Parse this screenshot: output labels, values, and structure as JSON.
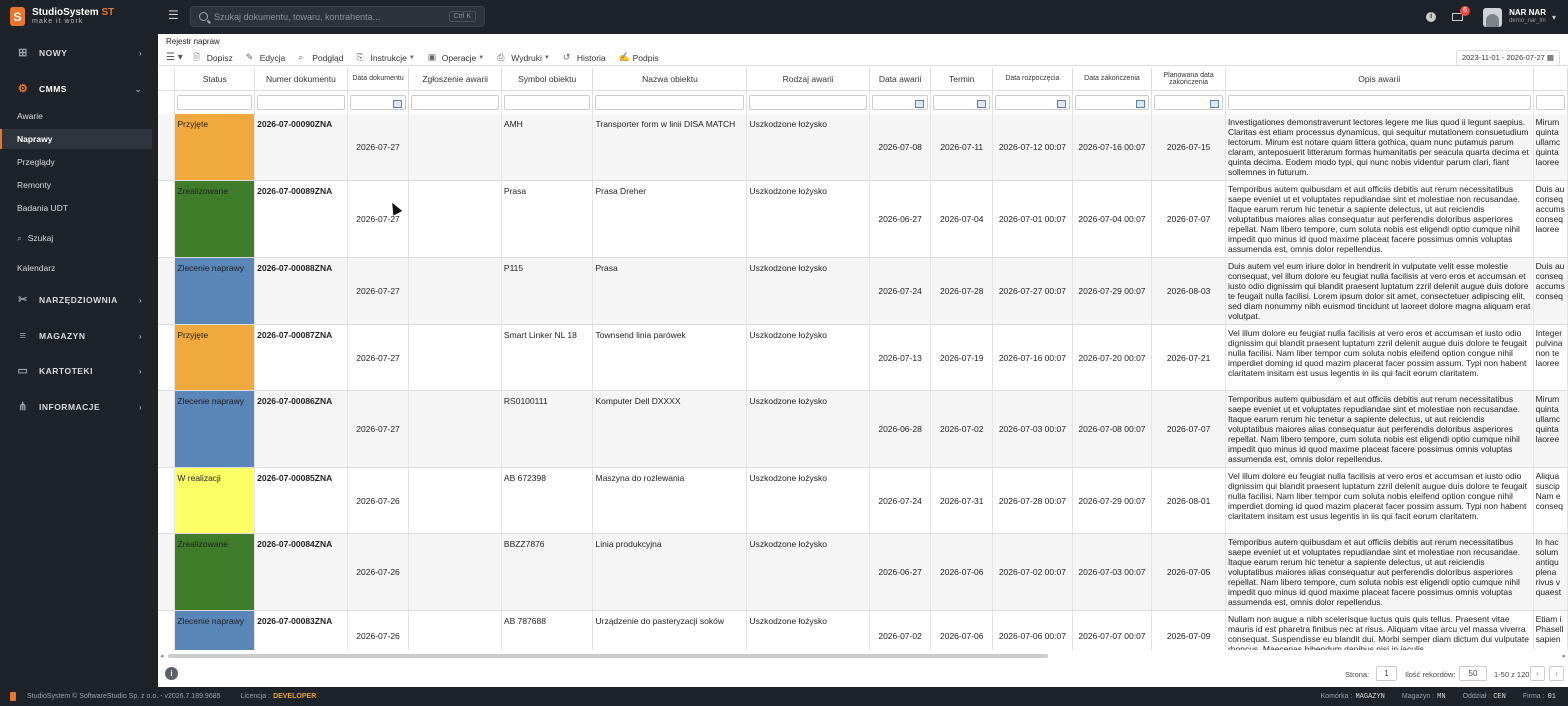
{
  "app": {
    "name": "StudioSystem",
    "name_suffix": "ST",
    "tagline": "make it work"
  },
  "search": {
    "placeholder": "Szukaj dokumentu, towaru, kontrahenta...",
    "shortcut": "Ctrl K"
  },
  "header": {
    "mail_badge": "6",
    "user_name": "NAR NAR",
    "user_login": "demo_nar_lm"
  },
  "sidebar": {
    "groups": [
      {
        "label": "NOWY",
        "icon": "plus-square-icon"
      },
      {
        "label": "CMMS",
        "icon": "gears-icon"
      },
      {
        "label": "NARZĘDZIOWNIA",
        "icon": "tools-icon"
      },
      {
        "label": "MAGAZYN",
        "icon": "pallet-icon"
      },
      {
        "label": "KARTOTEKI",
        "icon": "folder-icon"
      },
      {
        "label": "INFORMACJE",
        "icon": "sitemap-icon"
      }
    ],
    "cmms_items": [
      "Awarie",
      "Naprawy",
      "Przeglądy",
      "Remonty",
      "Badania UDT"
    ],
    "search_label": "Szukaj",
    "calendar_label": "Kalendarz"
  },
  "breadcrumb": "Rejestr napraw",
  "toolbar": {
    "items": [
      "Dopisz",
      "Edycja",
      "Podgląd",
      "Instrukcje",
      "Operacje",
      "Wydruki",
      "Historia",
      "Podpis"
    ],
    "date_range": "2023-11-01 - 2026-07-27"
  },
  "table": {
    "columns": [
      "Status",
      "Numer dokumentu",
      "Data dokumentu",
      "Zgłoszenie awarii",
      "Symbol obiektu",
      "Nazwa obiektu",
      "Rodzaj awarii",
      "Data awarii",
      "Termin",
      "Data rozpoczęcia",
      "Data zakończenia",
      "Planowana data zakończenia",
      "Opis awarii"
    ],
    "rows": [
      {
        "status": "Przyjęte",
        "status_color": "#f0a93c",
        "numer": "2026-07-00090ZNA",
        "data_dok": "2026-07-27",
        "zgloszenie": "",
        "symbol": "AMH",
        "nazwa": "Transporter form w linii DISA MATCH",
        "rodzaj": "Uszkodzone łożysko",
        "data_awarii": "2026-07-08",
        "termin": "2026-07-11",
        "data_rozp": "2026-07-12 00:07",
        "data_zak": "2026-07-16 00:07",
        "plan_zak": "2026-07-15",
        "opis": "Investigationes demonstraverunt lectores legere me lius quod ii legunt saepius. Claritas est etiam processus dynamicus, qui sequitur mutationem consuetudium lectorum. Mirum est notare quam littera gothica, quam nunc putamus parum claram, anteposuerit litterarum formas humanitatis per seacula quarta decima et quinta decima. Eodem modo typi, qui nunc nobis videntur parum clari, fiant sollemnes in futurum.",
        "opis2": "Mirum quinta ullamc quinta laoree"
      },
      {
        "status": "Zrealizowane",
        "status_color": "#3f7d2a",
        "numer": "2026-07-00089ZNA",
        "data_dok": "2026-07-27",
        "zgloszenie": "",
        "symbol": "Prasa",
        "nazwa": "Prasa Dreher",
        "rodzaj": "Uszkodzone łożysko",
        "data_awarii": "2026-06-27",
        "termin": "2026-07-04",
        "data_rozp": "2026-07-01 00:07",
        "data_zak": "2026-07-04 00:07",
        "plan_zak": "2026-07-07",
        "opis": "Temporibus autem quibusdam et aut officiis debitis aut rerum necessitatibus saepe eveniet ut et voluptates repudiandae sint et molestiae non recusandae. Itaque earum rerum hic tenetur a sapiente delectus, ut aut reiciendis voluptatibus maiores alias consequatur aut perferendis doloribus asperiores repellat. Nam libero tempore, cum soluta nobis est eligendi optio cumque nihil impedit quo minus id quod maxime placeat facere possimus omnis voluptas assumenda est, omnis dolor repellendus.",
        "opis2": "Duis au conseq accums conseq laoree"
      },
      {
        "status": "Zlecenie naprawy",
        "status_color": "#5b86b8",
        "numer": "2026-07-00088ZNA",
        "data_dok": "2026-07-27",
        "zgloszenie": "",
        "symbol": "P115",
        "nazwa": "Prasa",
        "rodzaj": "Uszkodzone łożysko",
        "data_awarii": "2026-07-24",
        "termin": "2026-07-28",
        "data_rozp": "2026-07-27 00:07",
        "data_zak": "2026-07-29 00:07",
        "plan_zak": "2026-08-03",
        "opis": "Duis autem vel eum iriure dolor in hendrerit in vulputate velit esse molestie consequat, vel illum dolore eu feugiat nulla facilisis at vero eros et accumsan et iusto odio dignissim qui blandit praesent luptatum zzril delenit augue duis dolore te feugait nulla facilisi. Lorem ipsum dolor sit amet, consectetuer adipiscing elit, sed diam nonummy nibh euismod tincidunt ut laoreet dolore magna aliquam erat volutpat.",
        "opis2": "Duis au conseq accums conseq"
      },
      {
        "status": "Przyjęte",
        "status_color": "#f0a93c",
        "numer": "2026-07-00087ZNA",
        "data_dok": "2026-07-27",
        "zgloszenie": "",
        "symbol": "Smart Linker NL 18",
        "nazwa": "Townsend linia parówek",
        "rodzaj": "Uszkodzone łożysko",
        "data_awarii": "2026-07-13",
        "termin": "2026-07-19",
        "data_rozp": "2026-07-16 00:07",
        "data_zak": "2026-07-20 00:07",
        "plan_zak": "2026-07-21",
        "opis": "Vel illum dolore eu feugiat nulla facilisis at vero eros et accumsan et iusto odio dignissim qui blandit praesent luptatum zzril delenit augue duis dolore te feugait nulla facilisi. Nam liber tempor cum soluta nobis eleifend option congue nihil imperdiet doming id quod mazim placerat facer possim assum. Typi non habent claritatem insitam est usus legentis in iis qui facit eorum claritatem.",
        "opis2": "Integer pulvina non te laoree"
      },
      {
        "status": "Zlecenie naprawy",
        "status_color": "#5b86b8",
        "numer": "2026-07-00086ZNA",
        "data_dok": "2026-07-27",
        "zgloszenie": "",
        "symbol": "RS0100111",
        "nazwa": "Komputer Dell DXXXX",
        "rodzaj": "Uszkodzone łożysko",
        "data_awarii": "2026-06-28",
        "termin": "2026-07-02",
        "data_rozp": "2026-07-03 00:07",
        "data_zak": "2026-07-08 00:07",
        "plan_zak": "2026-07-07",
        "opis": "Temporibus autem quibusdam et aut officiis debitis aut rerum necessitatibus saepe eveniet ut et voluptates repudiandae sint et molestiae non recusandae. Itaque earum rerum hic tenetur a sapiente delectus, ut aut reiciendis voluptatibus maiores alias consequatur aut perferendis doloribus asperiores repellat. Nam libero tempore, cum soluta nobis est eligendi optio cumque nihil impedit quo minus id quod maxime placeat facere possimus omnis voluptas assumenda est, omnis dolor repellendus.",
        "opis2": "Mirum quinta ullamc quinta laoree"
      },
      {
        "status": "W realizacji",
        "status_color": "#ffff66",
        "numer": "2026-07-00085ZNA",
        "data_dok": "2026-07-26",
        "zgloszenie": "",
        "symbol": "AB 672398",
        "nazwa": "Maszyna do rozlewania",
        "rodzaj": "Uszkodzone łożysko",
        "data_awarii": "2026-07-24",
        "termin": "2026-07-31",
        "data_rozp": "2026-07-28 00:07",
        "data_zak": "2026-07-29 00:07",
        "plan_zak": "2026-08-01",
        "opis": "Vel illum dolore eu feugiat nulla facilisis at vero eros et accumsan et iusto odio dignissim qui blandit praesent luptatum zzril delenit augue duis dolore te feugait nulla facilisi. Nam liber tempor cum soluta nobis eleifend option congue nihil imperdiet doming id quod mazim placerat facer possim assum. Typi non habent claritatem insitam est usus legentis in iis qui facit eorum claritatem.",
        "opis2": "Aliqua suscip Nam e conseq"
      },
      {
        "status": "Zrealizowane",
        "status_color": "#3f7d2a",
        "numer": "2026-07-00084ZNA",
        "data_dok": "2026-07-26",
        "zgloszenie": "",
        "symbol": "BBZZ7876",
        "nazwa": "Linia produkcyjna",
        "rodzaj": "Uszkodzone łożysko",
        "data_awarii": "2026-06-27",
        "termin": "2026-07-06",
        "data_rozp": "2026-07-02 00:07",
        "data_zak": "2026-07-03 00:07",
        "plan_zak": "2026-07-05",
        "opis": "Temporibus autem quibusdam et aut officiis debitis aut rerum necessitatibus saepe eveniet ut et voluptates repudiandae sint et molestiae non recusandae. Itaque earum rerum hic tenetur a sapiente delectus, ut aut reiciendis voluptatibus maiores alias consequatur aut perferendis doloribus asperiores repellat. Nam libero tempore, cum soluta nobis est eligendi optio cumque nihil impedit quo minus id quod maxime placeat facere possimus omnis voluptas assumenda est, omnis dolor repellendus.",
        "opis2": "In hac solum antiqu plena rivus v quaest"
      },
      {
        "status": "Zlecenie naprawy",
        "status_color": "#5b86b8",
        "numer": "2026-07-00083ZNA",
        "data_dok": "2026-07-26",
        "zgloszenie": "",
        "symbol": "AB 787688",
        "nazwa": "Urządzenie do pasteryzacji soków",
        "rodzaj": "Uszkodzone łożysko",
        "data_awarii": "2026-07-02",
        "termin": "2026-07-06",
        "data_rozp": "2026-07-06 00:07",
        "data_zak": "2026-07-07 00:07",
        "plan_zak": "2026-07-09",
        "opis": "Nullam non augue a nibh scelerisque luctus quis quis tellus. Praesent vitae mauris id est pharetra finibus nec at risus. Aliquam vitae arcu vel massa viverra consequat. Suspendisse eu blandit dui. Morbi semper diam dictum dui vulputate rhoncus. Maecenas bibendum dapibus nisi in iaculis.",
        "opis2": "Etiam i Phasell sapien"
      }
    ]
  },
  "pager": {
    "page_label": "Strona:",
    "page": "1",
    "count_label": "Ilość rekordów:",
    "count": "50",
    "range": "1-50 z 120"
  },
  "statusbar": {
    "copyright": "StudioSystem © SoftwareStudio Sp. z o.o. - v2026.7.189.9685",
    "license_label": "Licencja :",
    "license": "DEVELOPER",
    "komorka_label": "Komórka :",
    "komorka": "MAGAZYN",
    "magazyn_label": "Magazyn :",
    "magazyn": "MN",
    "oddzial_label": "Oddział :",
    "oddzial": "CEN",
    "firma_label": "Firma :",
    "firma": "01"
  }
}
